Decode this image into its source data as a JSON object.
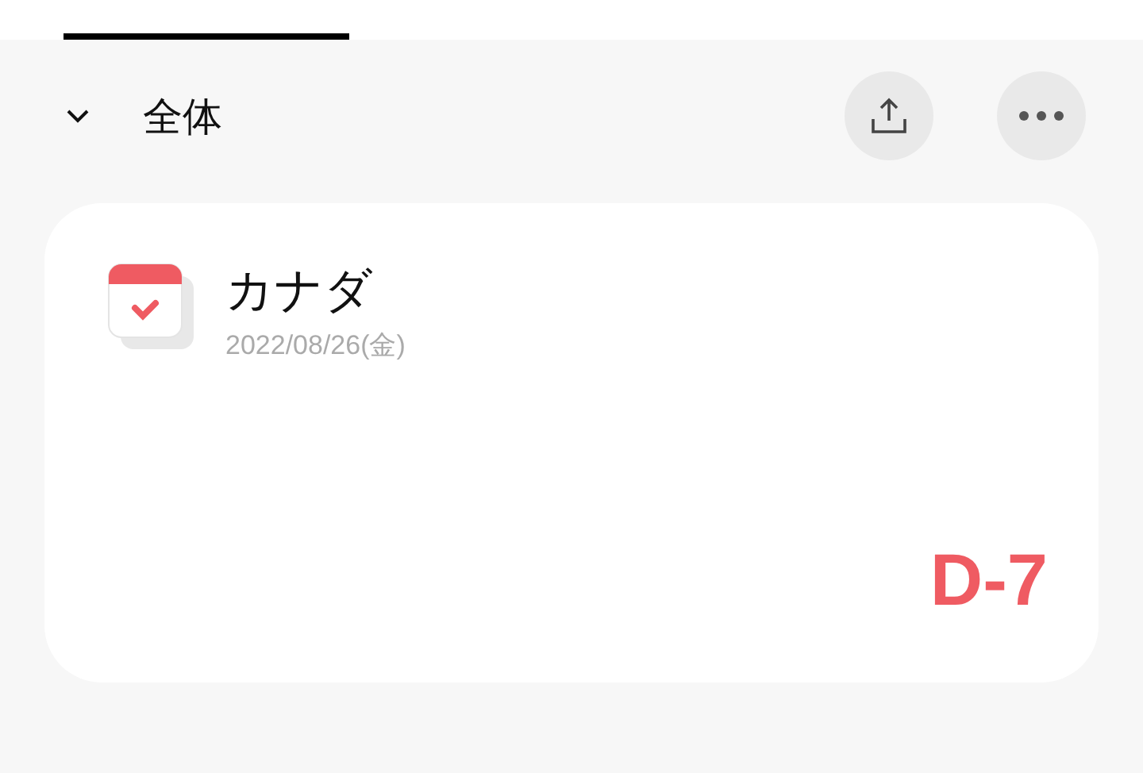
{
  "header": {
    "expanded": true,
    "title": "全体"
  },
  "cards": [
    {
      "title": "カナダ",
      "date": "2022/08/26(金)",
      "countdown": "D-7"
    }
  ]
}
